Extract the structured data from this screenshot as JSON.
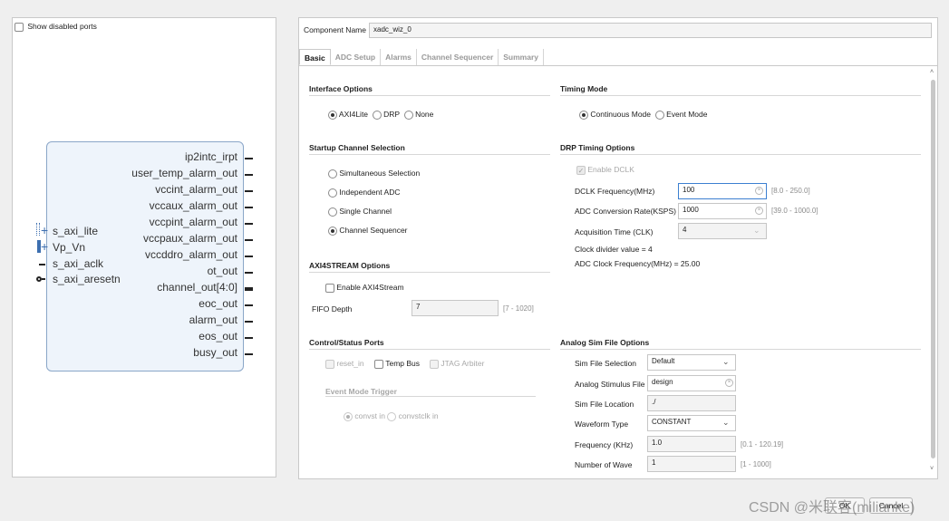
{
  "left_panel": {
    "show_disabled_label": "Show disabled ports",
    "ports_left": [
      "s_axi_lite",
      "Vp_Vn",
      "s_axi_aclk",
      "s_axi_aresetn"
    ],
    "ports_right": [
      "ip2intc_irpt",
      "user_temp_alarm_out",
      "vccint_alarm_out",
      "vccaux_alarm_out",
      "vccpint_alarm_out",
      "vccpaux_alarm_out",
      "vccddro_alarm_out",
      "ot_out",
      "channel_out[4:0]",
      "eoc_out",
      "alarm_out",
      "eos_out",
      "busy_out"
    ]
  },
  "component": {
    "label": "Component Name",
    "value": "xadc_wiz_0"
  },
  "tabs": [
    "Basic",
    "ADC Setup",
    "Alarms",
    "Channel Sequencer",
    "Summary"
  ],
  "interface_options": {
    "title": "Interface Options",
    "options": [
      "AXI4Lite",
      "DRP",
      "None"
    ]
  },
  "startup_channel": {
    "title": "Startup Channel Selection",
    "options": [
      "Simultaneous Selection",
      "Independent ADC",
      "Single Channel",
      "Channel Sequencer"
    ]
  },
  "axi4stream": {
    "title": "AXI4STREAM Options",
    "enable_label": "Enable AXI4Stream",
    "fifo_label": "FIFO Depth",
    "fifo_value": "7",
    "fifo_range": "[7 - 1020]"
  },
  "control_status": {
    "title": "Control/Status Ports",
    "reset_label": "reset_in",
    "temp_bus_label": "Temp Bus",
    "jtag_label": "JTAG Arbiter",
    "event_trigger_title": "Event Mode Trigger",
    "convst_label": "convst in",
    "convstclk_label": "convstclk in"
  },
  "timing_mode": {
    "title": "Timing Mode",
    "options": [
      "Continuous Mode",
      "Event Mode"
    ]
  },
  "drp_timing": {
    "title": "DRP Timing Options",
    "enable_dclk": "Enable DCLK",
    "dclk_label": "DCLK Frequency(MHz)",
    "dclk_value": "100",
    "dclk_range": "[8.0 - 250.0]",
    "adc_rate_label": "ADC Conversion Rate(KSPS)",
    "adc_rate_value": "1000",
    "adc_rate_range": "[39.0 - 1000.0]",
    "acq_label": "Acquisition Time (CLK)",
    "acq_value": "4",
    "clock_div": "Clock divider value = 4",
    "adc_clock": "ADC Clock Frequency(MHz) = 25.00"
  },
  "analog_sim": {
    "title": "Analog Sim File Options",
    "sim_file_sel_label": "Sim File Selection",
    "sim_file_sel_value": "Default",
    "stimulus_label": "Analog Stimulus File",
    "stimulus_value": "design",
    "location_label": "Sim File Location",
    "location_value": "./",
    "waveform_label": "Waveform Type",
    "waveform_value": "CONSTANT",
    "freq_label": "Frequency (KHz)",
    "freq_value": "1.0",
    "freq_range": "[0.1 - 120.19]",
    "nwave_label": "Number of Wave",
    "nwave_value": "1",
    "nwave_range": "[1 - 1000]"
  },
  "watermark": "CSDN @米联客(milianke)",
  "ok_label": "OK",
  "cancel_label": "Cancel"
}
